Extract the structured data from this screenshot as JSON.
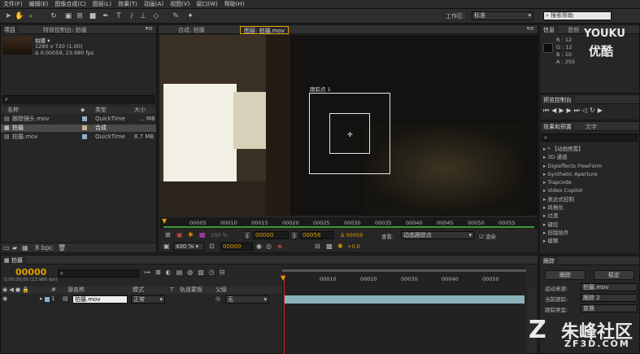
{
  "menu": [
    "文件(F)",
    "编辑(E)",
    "图像合成(C)",
    "图层(L)",
    "效果(T)",
    "动画(A)",
    "视图(V)",
    "窗口(W)",
    "帮助(H)"
  ],
  "toolbar": {
    "workspace_label": "工作区:",
    "workspace_value": "标准",
    "search_placeholder": "搜索帮助"
  },
  "project": {
    "tabs": [
      "项目",
      "特效控制台: 拍摄"
    ],
    "preview_name": "拍摄 ▾",
    "preview_info1": "1280 x 720 (1.00)",
    "preview_info2": "Δ 0;00059, 23.980 fps",
    "col_name": "名称",
    "col_type": "类型",
    "col_size": "大小",
    "items": [
      {
        "name": "跟踪镜头.mov",
        "type": "QuickTime",
        "size": "... MB"
      },
      {
        "name": "拍摄",
        "type": "合成",
        "size": ""
      },
      {
        "name": "拍摄.mov",
        "type": "QuickTime",
        "size": "8.7 MB"
      }
    ],
    "bpc": "8 bpc"
  },
  "viewer": {
    "tabs": [
      "合成: 拍摄",
      "图层: 拍摄.mov"
    ],
    "track_label": "跟踪点 1",
    "ruler": [
      "00005",
      "00010",
      "00015",
      "00020",
      "00025",
      "00030",
      "00035",
      "00040",
      "00045",
      "00050",
      "00055"
    ],
    "start_time": "00000",
    "end_time": "00058",
    "duration": "Δ 00059",
    "view_label": "查看:",
    "view_value": "动态跟踪点",
    "render_label": "渲染",
    "zoom": "400 %",
    "current_time": "00000",
    "exposure": "+0.0",
    "percent": "100 %"
  },
  "info": {
    "tabs": [
      "信息",
      "音频"
    ],
    "r": "R : 12",
    "g": "G : 12",
    "b": "B : 10",
    "a": "A : 255"
  },
  "preview_panel": {
    "title": "预览控制台"
  },
  "effects": {
    "tabs": [
      "效果和预置",
      "文字"
    ],
    "items": [
      "* 【动画预置】",
      "3D 通道",
      "Digieffects FreeForm",
      "Synthetic Aperture",
      "Trapcode",
      "Video Copilot",
      "表达式控制",
      "风格化",
      "过渡",
      "键控",
      "旧版插件",
      "模糊"
    ]
  },
  "tracker": {
    "title": "跟踪",
    "track_btn": "跟踪",
    "stabilize_btn": "稳定",
    "source_label": "运动来源:",
    "source_value": "拍摄.mov",
    "current_label": "当前跟踪:",
    "current_value": "跟踪 2",
    "type_label": "跟踪类型:",
    "type_value": "变换"
  },
  "timeline": {
    "tab": "拍摄",
    "timecode": "00000",
    "timecode_sub": "0;00;00;00 (23.980 fps)",
    "col_num": "#",
    "col_source": "源名称",
    "col_mode": "模式",
    "col_t": "T",
    "col_trkmat": "轨道蒙板",
    "col_parent": "父级",
    "layer_num": "1",
    "layer_name": "拍摄.mov",
    "layer_mode": "正常",
    "layer_parent": "无",
    "ruler": [
      "00010",
      "00020",
      "00030",
      "00040",
      "00050"
    ]
  },
  "watermarks": {
    "youku_en": "YOUKU",
    "youku_cn": "优酷",
    "zf_cn": "朱峰社区",
    "zf_url": "ZF3D.COM"
  },
  "colors": {
    "accent": "#e0a000",
    "layer_bar": "#8ab2b8",
    "playhead": "#cc2222"
  }
}
